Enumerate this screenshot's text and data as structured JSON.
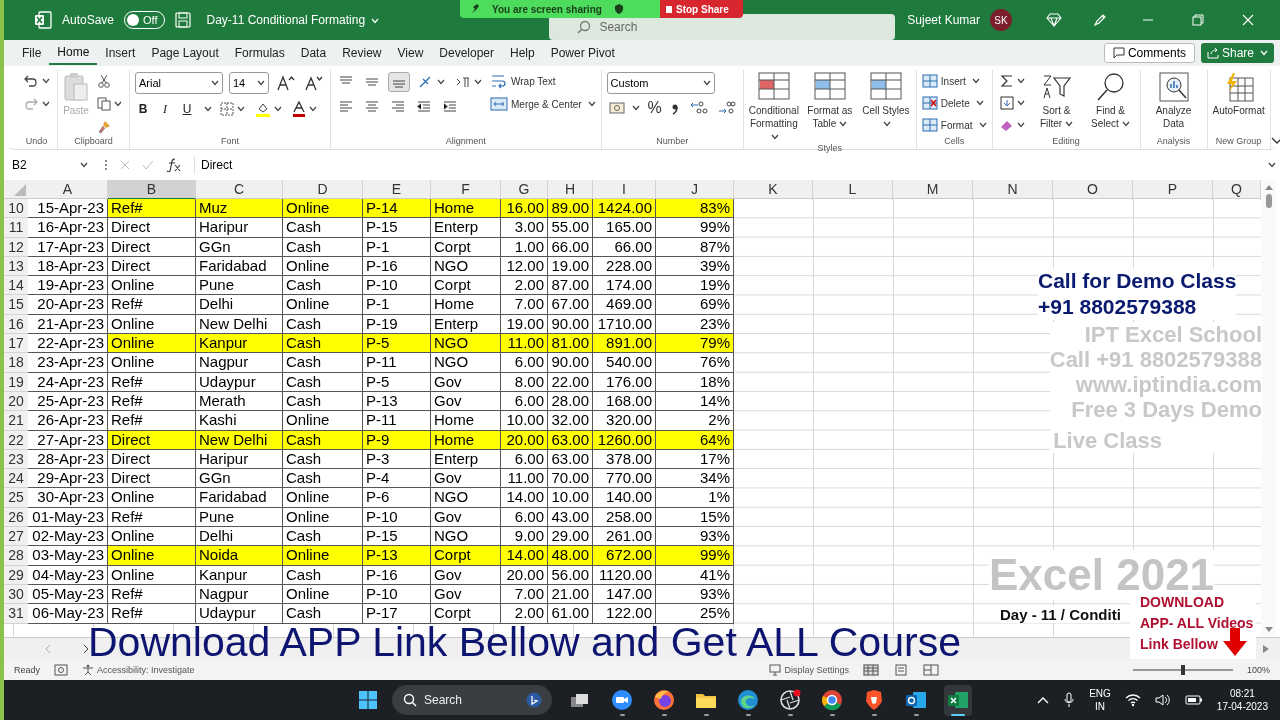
{
  "title_bar": {
    "autosave_label": "AutoSave",
    "autosave_on": false,
    "toggle_text": "Off",
    "file_name": "Day-11 Conditional Formating",
    "search_placeholder": "Search",
    "user_name": "Sujeet Kumar",
    "avatar_initials": "SK"
  },
  "share_banner": {
    "message": "You are screen sharing",
    "stop_label": "Stop Share"
  },
  "menu_tabs": [
    {
      "label": "File",
      "selected": false
    },
    {
      "label": "Home",
      "selected": true
    },
    {
      "label": "Insert",
      "selected": false
    },
    {
      "label": "Page Layout",
      "selected": false
    },
    {
      "label": "Formulas",
      "selected": false
    },
    {
      "label": "Data",
      "selected": false
    },
    {
      "label": "Review",
      "selected": false
    },
    {
      "label": "View",
      "selected": false
    },
    {
      "label": "Developer",
      "selected": false
    },
    {
      "label": "Help",
      "selected": false
    },
    {
      "label": "Power Pivot",
      "selected": false
    }
  ],
  "comments_label": "Comments",
  "share_label": "Share",
  "ribbon_groups": [
    {
      "kind": "undo",
      "label": "Undo"
    },
    {
      "kind": "clipboard",
      "label": "Clipboard",
      "paste_label": "Paste",
      "paste_disabled": true
    },
    {
      "kind": "font",
      "label": "Font",
      "font_name": "Arial",
      "font_size": "14",
      "bold": "B",
      "italic": "I",
      "underline": "U"
    },
    {
      "kind": "alignment",
      "label": "Alignment",
      "wrap_label": "Wrap Text",
      "merge_label": "Merge & Center"
    },
    {
      "kind": "number",
      "label": "Number",
      "format": "Custom",
      "percent": "%"
    },
    {
      "kind": "styles",
      "label": "Styles",
      "buttons": [
        "Conditional Formatting",
        "Format as Table",
        "Cell Styles"
      ]
    },
    {
      "kind": "cells",
      "label": "Cells",
      "buttons": [
        "Insert",
        "Delete",
        "Format"
      ]
    },
    {
      "kind": "editing",
      "label": "Editing",
      "buttons": [
        "Sort & Filter",
        "Find & Select"
      ]
    },
    {
      "kind": "analysis",
      "label": "Analysis",
      "buttons": [
        "Analyze Data"
      ]
    },
    {
      "kind": "newgroup",
      "label": "New Group",
      "buttons": [
        "AutoFormat"
      ]
    }
  ],
  "formula_bar": {
    "name_box": "B2",
    "content": "Direct"
  },
  "columns": [
    {
      "label": "A",
      "selected": false
    },
    {
      "label": "B",
      "selected": true
    },
    {
      "label": "C",
      "selected": false
    },
    {
      "label": "D",
      "selected": false
    },
    {
      "label": "E",
      "selected": false
    },
    {
      "label": "F",
      "selected": false
    },
    {
      "label": "G",
      "selected": false
    },
    {
      "label": "H",
      "selected": false
    },
    {
      "label": "I",
      "selected": false
    },
    {
      "label": "J",
      "selected": false
    },
    {
      "label": "K",
      "selected": false
    },
    {
      "label": "L",
      "selected": false
    },
    {
      "label": "M",
      "selected": false
    },
    {
      "label": "N",
      "selected": false
    },
    {
      "label": "O",
      "selected": false
    },
    {
      "label": "P",
      "selected": false
    },
    {
      "label": "Q",
      "selected": false
    }
  ],
  "rows": [
    {
      "number": "10",
      "highlight": true,
      "cells": [
        "15-Apr-23",
        "Ref#",
        "Muz",
        "Online",
        "P-14",
        "Home",
        "16.00",
        "89.00",
        "1424.00",
        "83%"
      ]
    },
    {
      "number": "11",
      "highlight": false,
      "cells": [
        "16-Apr-23",
        "Direct",
        "Haripur",
        "Cash",
        "P-15",
        "Enterp",
        "3.00",
        "55.00",
        "165.00",
        "99%"
      ]
    },
    {
      "number": "12",
      "highlight": false,
      "cells": [
        "17-Apr-23",
        "Direct",
        "GGn",
        "Cash",
        "P-1",
        "Corpt",
        "1.00",
        "66.00",
        "66.00",
        "87%"
      ]
    },
    {
      "number": "13",
      "highlight": false,
      "cells": [
        "18-Apr-23",
        "Direct",
        "Faridabad",
        "Online",
        "P-16",
        "NGO",
        "12.00",
        "19.00",
        "228.00",
        "39%"
      ]
    },
    {
      "number": "14",
      "highlight": false,
      "cells": [
        "19-Apr-23",
        "Online",
        "Pune",
        "Cash",
        "P-10",
        "Corpt",
        "2.00",
        "87.00",
        "174.00",
        "19%"
      ]
    },
    {
      "number": "15",
      "highlight": false,
      "cells": [
        "20-Apr-23",
        "Ref#",
        "Delhi",
        "Online",
        "P-1",
        "Home",
        "7.00",
        "67.00",
        "469.00",
        "69%"
      ]
    },
    {
      "number": "16",
      "highlight": false,
      "cells": [
        "21-Apr-23",
        "Online",
        "New Delhi",
        "Cash",
        "P-19",
        "Enterp",
        "19.00",
        "90.00",
        "1710.00",
        "23%"
      ]
    },
    {
      "number": "17",
      "highlight": true,
      "cells": [
        "22-Apr-23",
        "Online",
        "Kanpur",
        "Cash",
        "P-5",
        "NGO",
        "11.00",
        "81.00",
        "891.00",
        "79%"
      ]
    },
    {
      "number": "18",
      "highlight": false,
      "cells": [
        "23-Apr-23",
        "Online",
        "Nagpur",
        "Cash",
        "P-11",
        "NGO",
        "6.00",
        "90.00",
        "540.00",
        "76%"
      ]
    },
    {
      "number": "19",
      "highlight": false,
      "cells": [
        "24-Apr-23",
        "Ref#",
        "Udaypur",
        "Cash",
        "P-5",
        "Gov",
        "8.00",
        "22.00",
        "176.00",
        "18%"
      ]
    },
    {
      "number": "20",
      "highlight": false,
      "cells": [
        "25-Apr-23",
        "Ref#",
        "Merath",
        "Cash",
        "P-13",
        "Gov",
        "6.00",
        "28.00",
        "168.00",
        "14%"
      ]
    },
    {
      "number": "21",
      "highlight": false,
      "cells": [
        "26-Apr-23",
        "Ref#",
        "Kashi",
        "Online",
        "P-11",
        "Home",
        "10.00",
        "32.00",
        "320.00",
        "2%"
      ]
    },
    {
      "number": "22",
      "highlight": true,
      "cells": [
        "27-Apr-23",
        "Direct",
        "New Delhi",
        "Cash",
        "P-9",
        "Home",
        "20.00",
        "63.00",
        "1260.00",
        "64%"
      ]
    },
    {
      "number": "23",
      "highlight": false,
      "cells": [
        "28-Apr-23",
        "Direct",
        "Haripur",
        "Cash",
        "P-3",
        "Enterp",
        "6.00",
        "63.00",
        "378.00",
        "17%"
      ]
    },
    {
      "number": "24",
      "highlight": false,
      "cells": [
        "29-Apr-23",
        "Direct",
        "GGn",
        "Cash",
        "P-4",
        "Gov",
        "11.00",
        "70.00",
        "770.00",
        "34%"
      ]
    },
    {
      "number": "25",
      "highlight": false,
      "cells": [
        "30-Apr-23",
        "Online",
        "Faridabad",
        "Online",
        "P-6",
        "NGO",
        "14.00",
        "10.00",
        "140.00",
        "1%"
      ]
    },
    {
      "number": "26",
      "highlight": false,
      "cells": [
        "01-May-23",
        "Ref#",
        "Pune",
        "Online",
        "P-10",
        "Gov",
        "6.00",
        "43.00",
        "258.00",
        "15%"
      ]
    },
    {
      "number": "27",
      "highlight": false,
      "cells": [
        "02-May-23",
        "Online",
        "Delhi",
        "Cash",
        "P-15",
        "NGO",
        "9.00",
        "29.00",
        "261.00",
        "93%"
      ]
    },
    {
      "number": "28",
      "highlight": true,
      "cells": [
        "03-May-23",
        "Online",
        "Noida",
        "Online",
        "P-13",
        "Corpt",
        "14.00",
        "48.00",
        "672.00",
        "99%"
      ]
    },
    {
      "number": "29",
      "highlight": false,
      "cells": [
        "04-May-23",
        "Online",
        "Kanpur",
        "Cash",
        "P-16",
        "Gov",
        "20.00",
        "56.00",
        "1120.00",
        "41%"
      ]
    },
    {
      "number": "30",
      "highlight": false,
      "cells": [
        "05-May-23",
        "Ref#",
        "Nagpur",
        "Online",
        "P-10",
        "Gov",
        "7.00",
        "21.00",
        "147.00",
        "93%"
      ]
    },
    {
      "number": "31",
      "highlight": false,
      "cells": [
        "06-May-23",
        "Ref#",
        "Udaypur",
        "Cash",
        "P-17",
        "Corpt",
        "2.00",
        "61.00",
        "122.00",
        "25%"
      ]
    }
  ],
  "promo": {
    "call_heading": "Call for Demo Class",
    "call_phone": "+91 8802579388",
    "watermark_lines": [
      "IPT Excel School",
      "Call +91 8802579388",
      "www.iptindia.com",
      "Free 3 Days Demo",
      "Live Class"
    ],
    "edition": "Excel 2021",
    "day_caption": "Day - 11 / Conditi",
    "download_lines": [
      "DOWNLOAD",
      "APP- ALL Videos",
      "Link Bellow"
    ],
    "banner": "Download APP Link Bellow and Get ALL Course"
  },
  "status_bar": {
    "mode": "Ready",
    "accessibility": "Accessibility: Investigate",
    "display_settings": "Display Settings",
    "zoom": "100%"
  },
  "taskbar": {
    "search_placeholder": "Search",
    "language": "ENG",
    "region": "IN",
    "time": "08:21",
    "date": "17-04-2023"
  }
}
